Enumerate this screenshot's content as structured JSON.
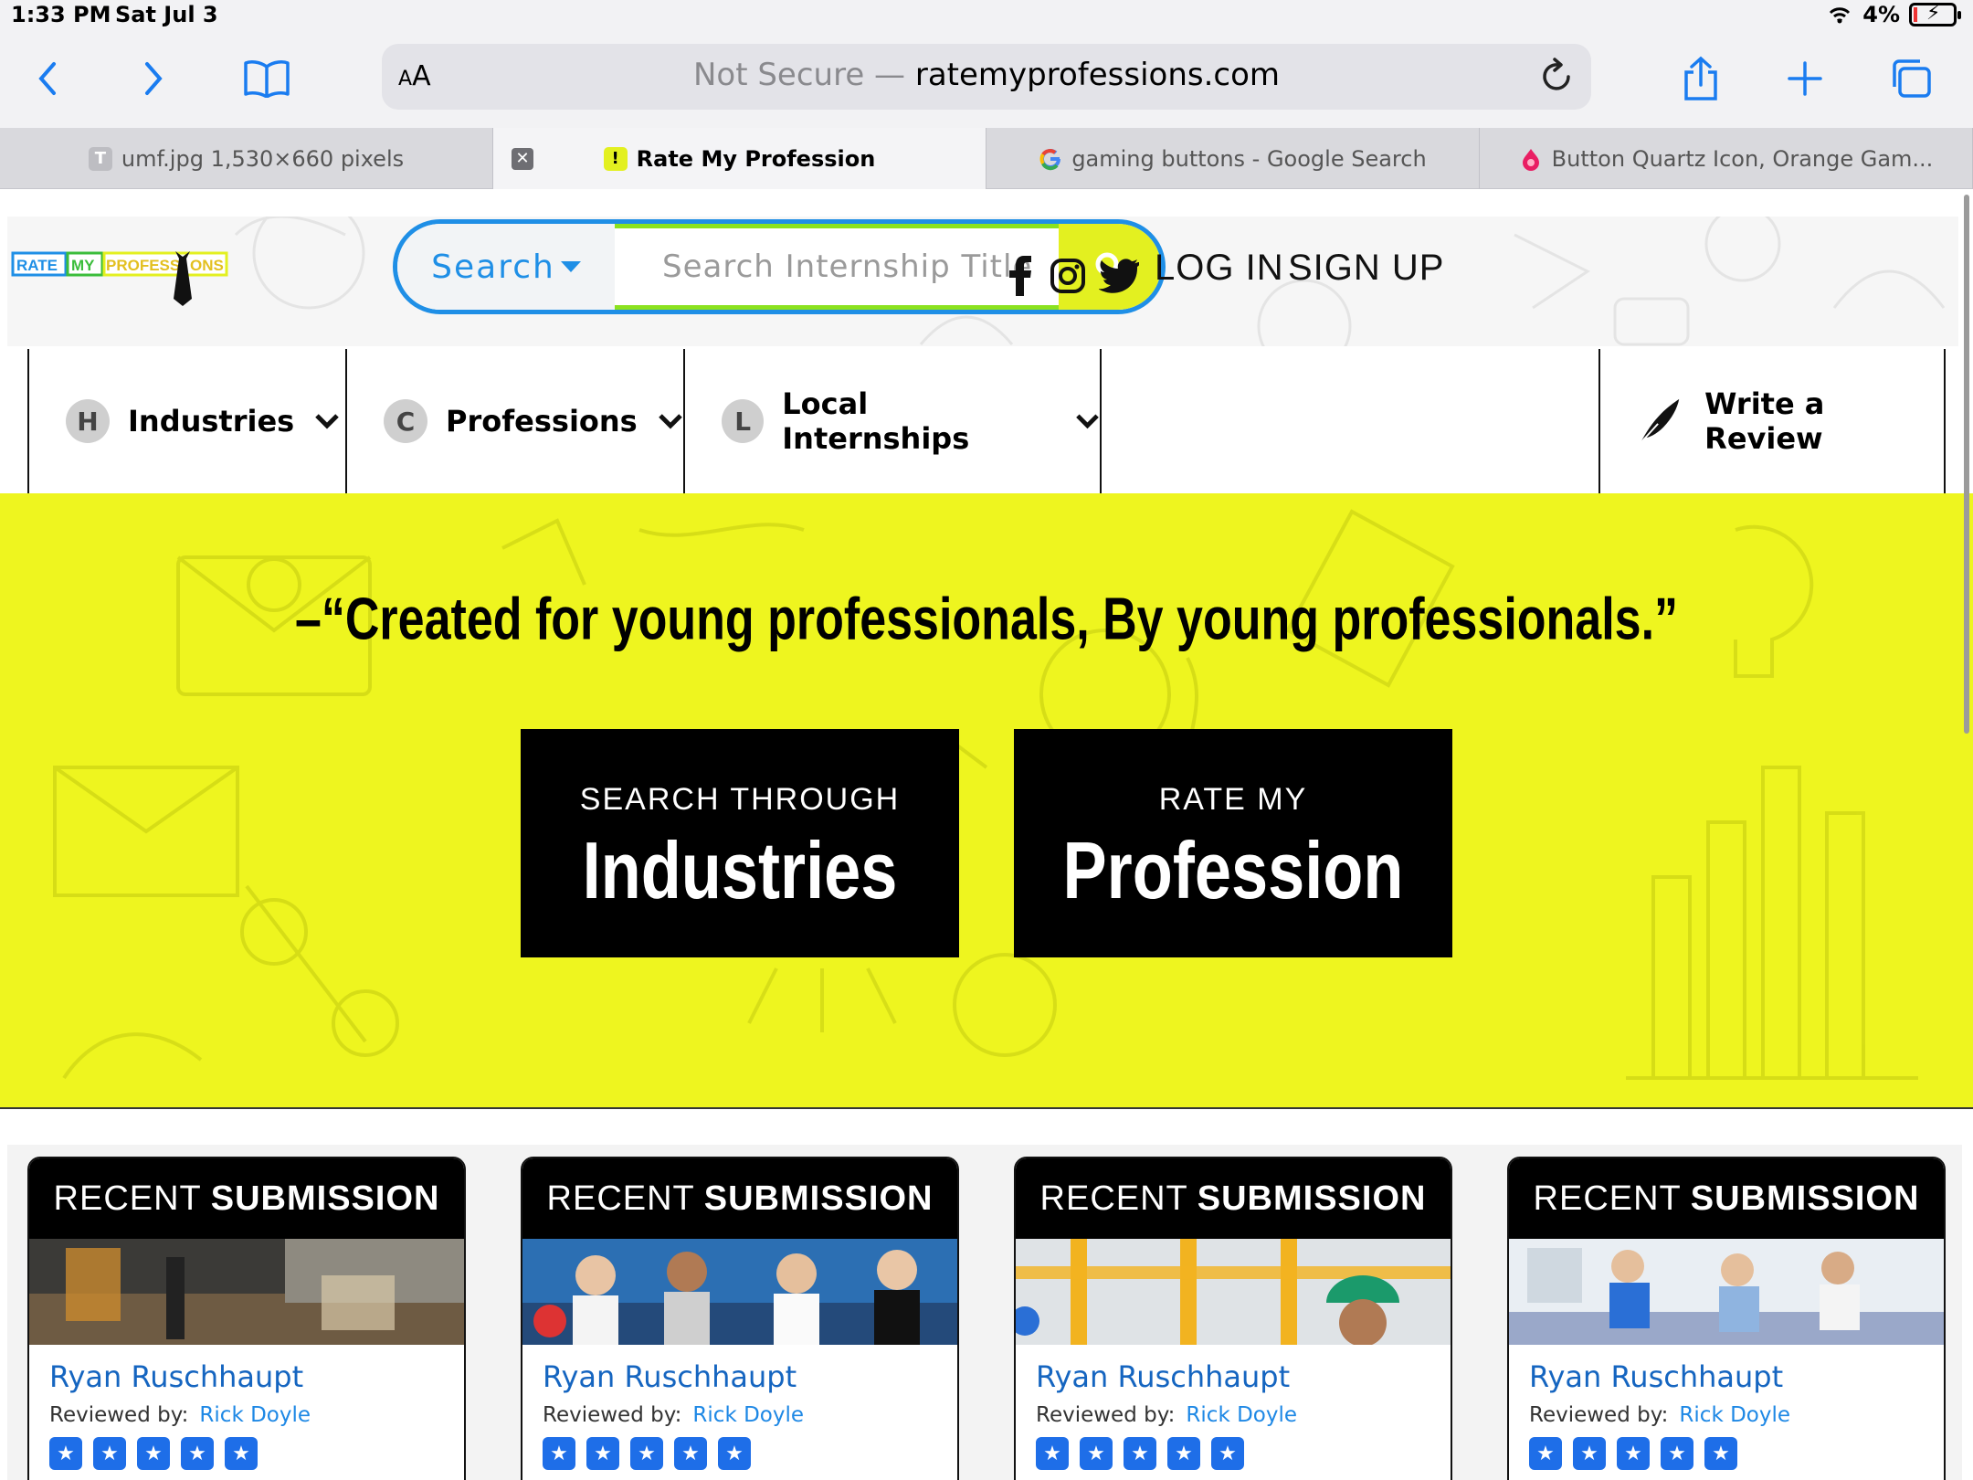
{
  "status_bar": {
    "time": "1:33 PM",
    "date": "Sat Jul 3",
    "battery": "4%"
  },
  "address_bar": {
    "aa": "AA",
    "not_secure": "Not Secure —",
    "domain": "ratemyprofessions.com"
  },
  "tabs": [
    {
      "favicon": "T",
      "title": "umf.jpg 1,530×660 pixels"
    },
    {
      "favicon": "!",
      "title": "Rate My Profession"
    },
    {
      "favicon": "G",
      "title": "gaming buttons - Google Search"
    },
    {
      "favicon": "",
      "title": "Button Quartz Icon, Orange Gam..."
    }
  ],
  "logo": {
    "words": [
      "RATE",
      "MY",
      "PROFESS",
      "ONS"
    ]
  },
  "search": {
    "dropdown_label": "Search",
    "placeholder": "Search Internship Title"
  },
  "auth": {
    "login": "LOG IN",
    "signup": "SIGN UP"
  },
  "nav": {
    "items": [
      {
        "badge": "H",
        "label": "Industries"
      },
      {
        "badge": "C",
        "label": "Professions"
      },
      {
        "badge": "L",
        "label": "Local Internships"
      }
    ],
    "write_review": "Write a Review"
  },
  "hero": {
    "tagline": "–“Created for young professionals, By young professionals.”",
    "cta_left": {
      "small": "SEARCH THROUGH",
      "big": "Industries"
    },
    "cta_right": {
      "small": "RATE MY",
      "big": "Profession"
    }
  },
  "recent": {
    "head_light": "RECENT",
    "head_bold": "SUBMISSION",
    "reviewed_by_label": "Reviewed by:",
    "cards": [
      {
        "name": "Ryan Ruschhaupt",
        "reviewer": "Rick Doyle",
        "stars": 5
      },
      {
        "name": "Ryan Ruschhaupt",
        "reviewer": "Rick Doyle",
        "stars": 5
      },
      {
        "name": "Ryan Ruschhaupt",
        "reviewer": "Rick Doyle",
        "stars": 5
      },
      {
        "name": "Ryan Ruschhaupt",
        "reviewer": "Rick Doyle",
        "stars": 5
      }
    ]
  },
  "colors": {
    "hero_yellow": "#eef51f",
    "search_blue": "#1f8fe6",
    "search_green": "#8be21f",
    "link_blue": "#1565c0"
  }
}
